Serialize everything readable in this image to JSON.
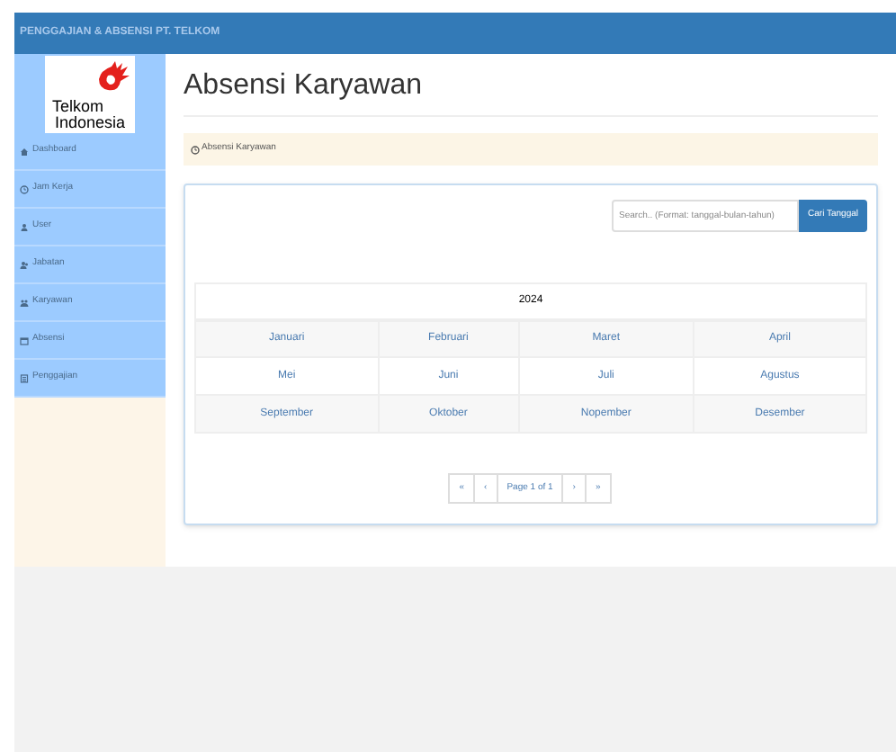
{
  "header": {
    "title": "PENGGAJIAN & ABSENSI PT. TELKOM"
  },
  "logo": {
    "line1": "Telkom",
    "line2": "Indonesia"
  },
  "sidebar": {
    "items": [
      {
        "label": "Dashboard"
      },
      {
        "label": "Jam Kerja"
      },
      {
        "label": "User"
      },
      {
        "label": "Jabatan"
      },
      {
        "label": "Karyawan"
      },
      {
        "label": "Absensi"
      },
      {
        "label": "Penggajian"
      }
    ]
  },
  "page_title": "Absensi Karyawan",
  "breadcrumb": "Absensi Karyawan",
  "search": {
    "placeholder": "Search.. (Format: tanggal-bulan-tahun)",
    "button": "Cari Tanggal"
  },
  "table": {
    "year": "2024",
    "rows": [
      [
        "Januari",
        "Februari",
        "Maret",
        "April"
      ],
      [
        "Mei",
        "Juni",
        "Juli",
        "Agustus"
      ],
      [
        "September",
        "Oktober",
        "Nopember",
        "Desember"
      ]
    ]
  },
  "pagination": [
    "«",
    "‹",
    "Page 1 of 1",
    "›",
    "»"
  ]
}
